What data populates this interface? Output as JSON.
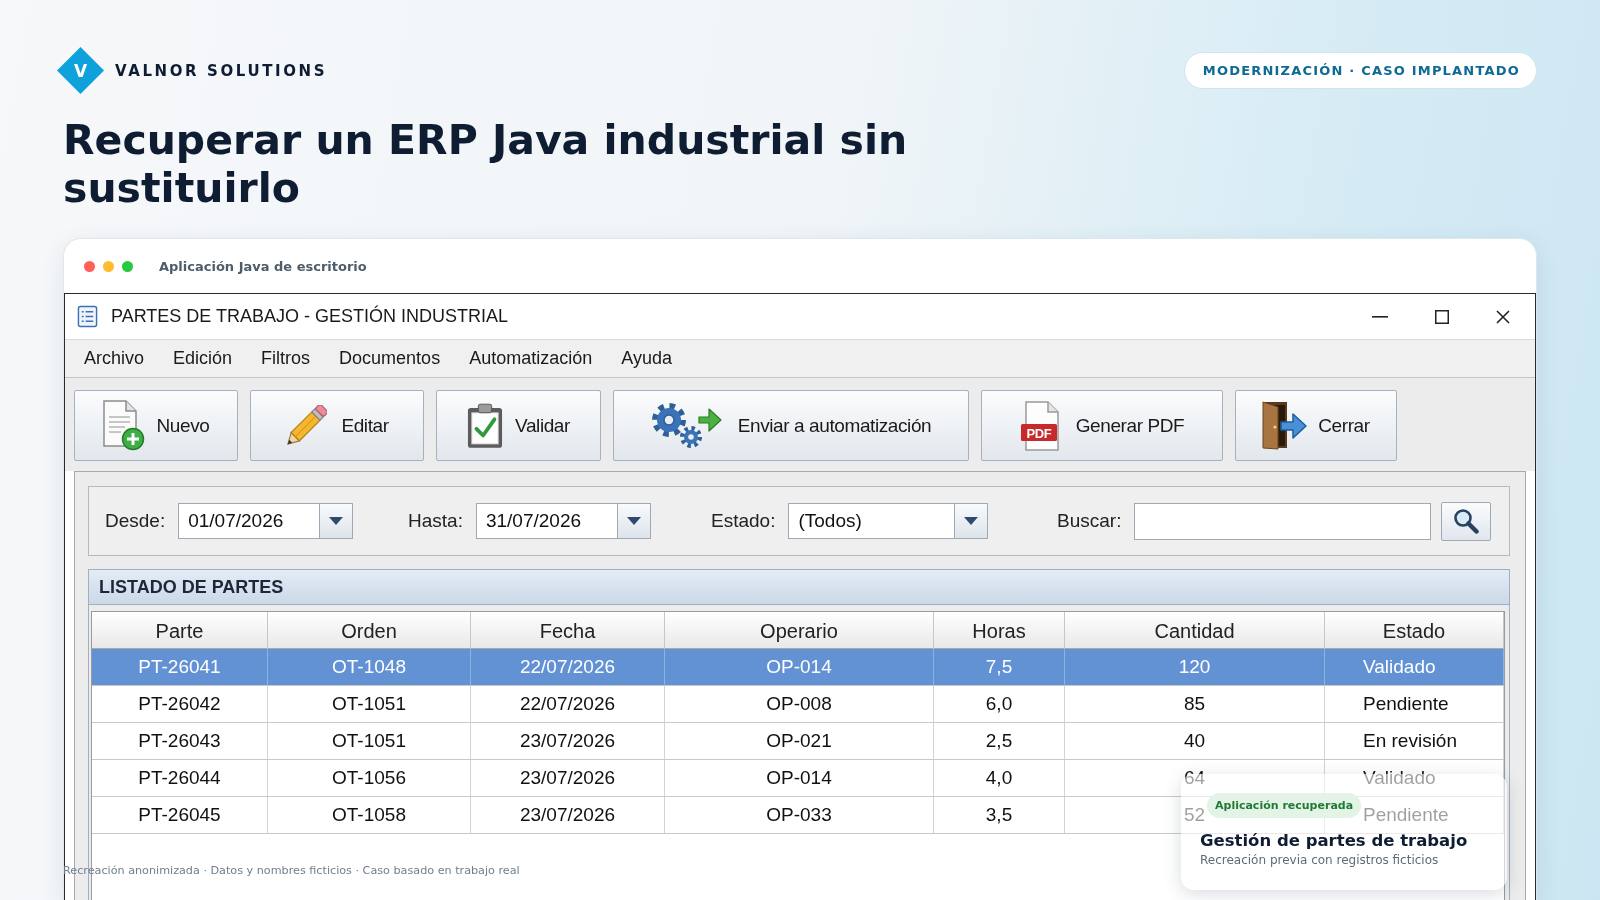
{
  "brand": {
    "mark": "V",
    "name": "VALNOR SOLUTIONS"
  },
  "tag": "MODERNIZACIÓN · CASO IMPLANTADO",
  "headline": "Recuperar un ERP Java industrial sin sustituirlo",
  "frame": {
    "caption": "Aplicación Java de escritorio"
  },
  "window": {
    "title": "PARTES DE TRABAJO - GESTIÓN INDUSTRIAL"
  },
  "menu": [
    "Archivo",
    "Edición",
    "Filtros",
    "Documentos",
    "Automatización",
    "Ayuda"
  ],
  "toolbar": [
    {
      "kind": "new",
      "label": "Nuevo"
    },
    {
      "kind": "edit",
      "label": "Editar"
    },
    {
      "kind": "validate",
      "label": "Validar"
    },
    {
      "kind": "automation",
      "label": "Enviar a automatización"
    },
    {
      "kind": "pdf",
      "label": "Generar PDF",
      "icon_text": "PDF"
    },
    {
      "kind": "close",
      "label": "Cerrar"
    }
  ],
  "filters": [
    {
      "kind": "date",
      "label": "Desde:",
      "value": "01/07/2026"
    },
    {
      "kind": "date",
      "label": "Hasta:",
      "value": "31/07/2026"
    },
    {
      "kind": "select",
      "label": "Estado:",
      "value": "(Todos)"
    },
    {
      "kind": "search",
      "label": "Buscar:"
    }
  ],
  "list": {
    "title": "LISTADO DE PARTES",
    "columns": [
      "Parte",
      "Orden",
      "Fecha",
      "Operario",
      "Horas",
      "Cantidad",
      "Estado"
    ],
    "rows": [
      {
        "selected": true,
        "cells": [
          "PT-26041",
          "OT-1048",
          "22/07/2026",
          "OP-014",
          "7,5",
          "120",
          "Validado"
        ]
      },
      {
        "selected": false,
        "cells": [
          "PT-26042",
          "OT-1051",
          "22/07/2026",
          "OP-008",
          "6,0",
          "85",
          "Pendiente"
        ]
      },
      {
        "selected": false,
        "cells": [
          "PT-26043",
          "OT-1051",
          "23/07/2026",
          "OP-021",
          "2,5",
          "40",
          "En revisión"
        ]
      },
      {
        "selected": false,
        "cells": [
          "PT-26044",
          "OT-1056",
          "23/07/2026",
          "OP-014",
          "4,0",
          "64",
          "Validado"
        ]
      },
      {
        "selected": false,
        "cells": [
          "PT-26045",
          "OT-1058",
          "23/07/2026",
          "OP-033",
          "3,5",
          "52",
          "Pendiente"
        ]
      }
    ]
  },
  "toast": {
    "badge": "Aplicación recuperada",
    "title": "Gestión de partes de trabajo",
    "subtitle": "Recreación previa con registros ficticios"
  },
  "footnote": "Recreación anonimizada · Datos y nombres ficticios · Caso basado en trabajo real"
}
